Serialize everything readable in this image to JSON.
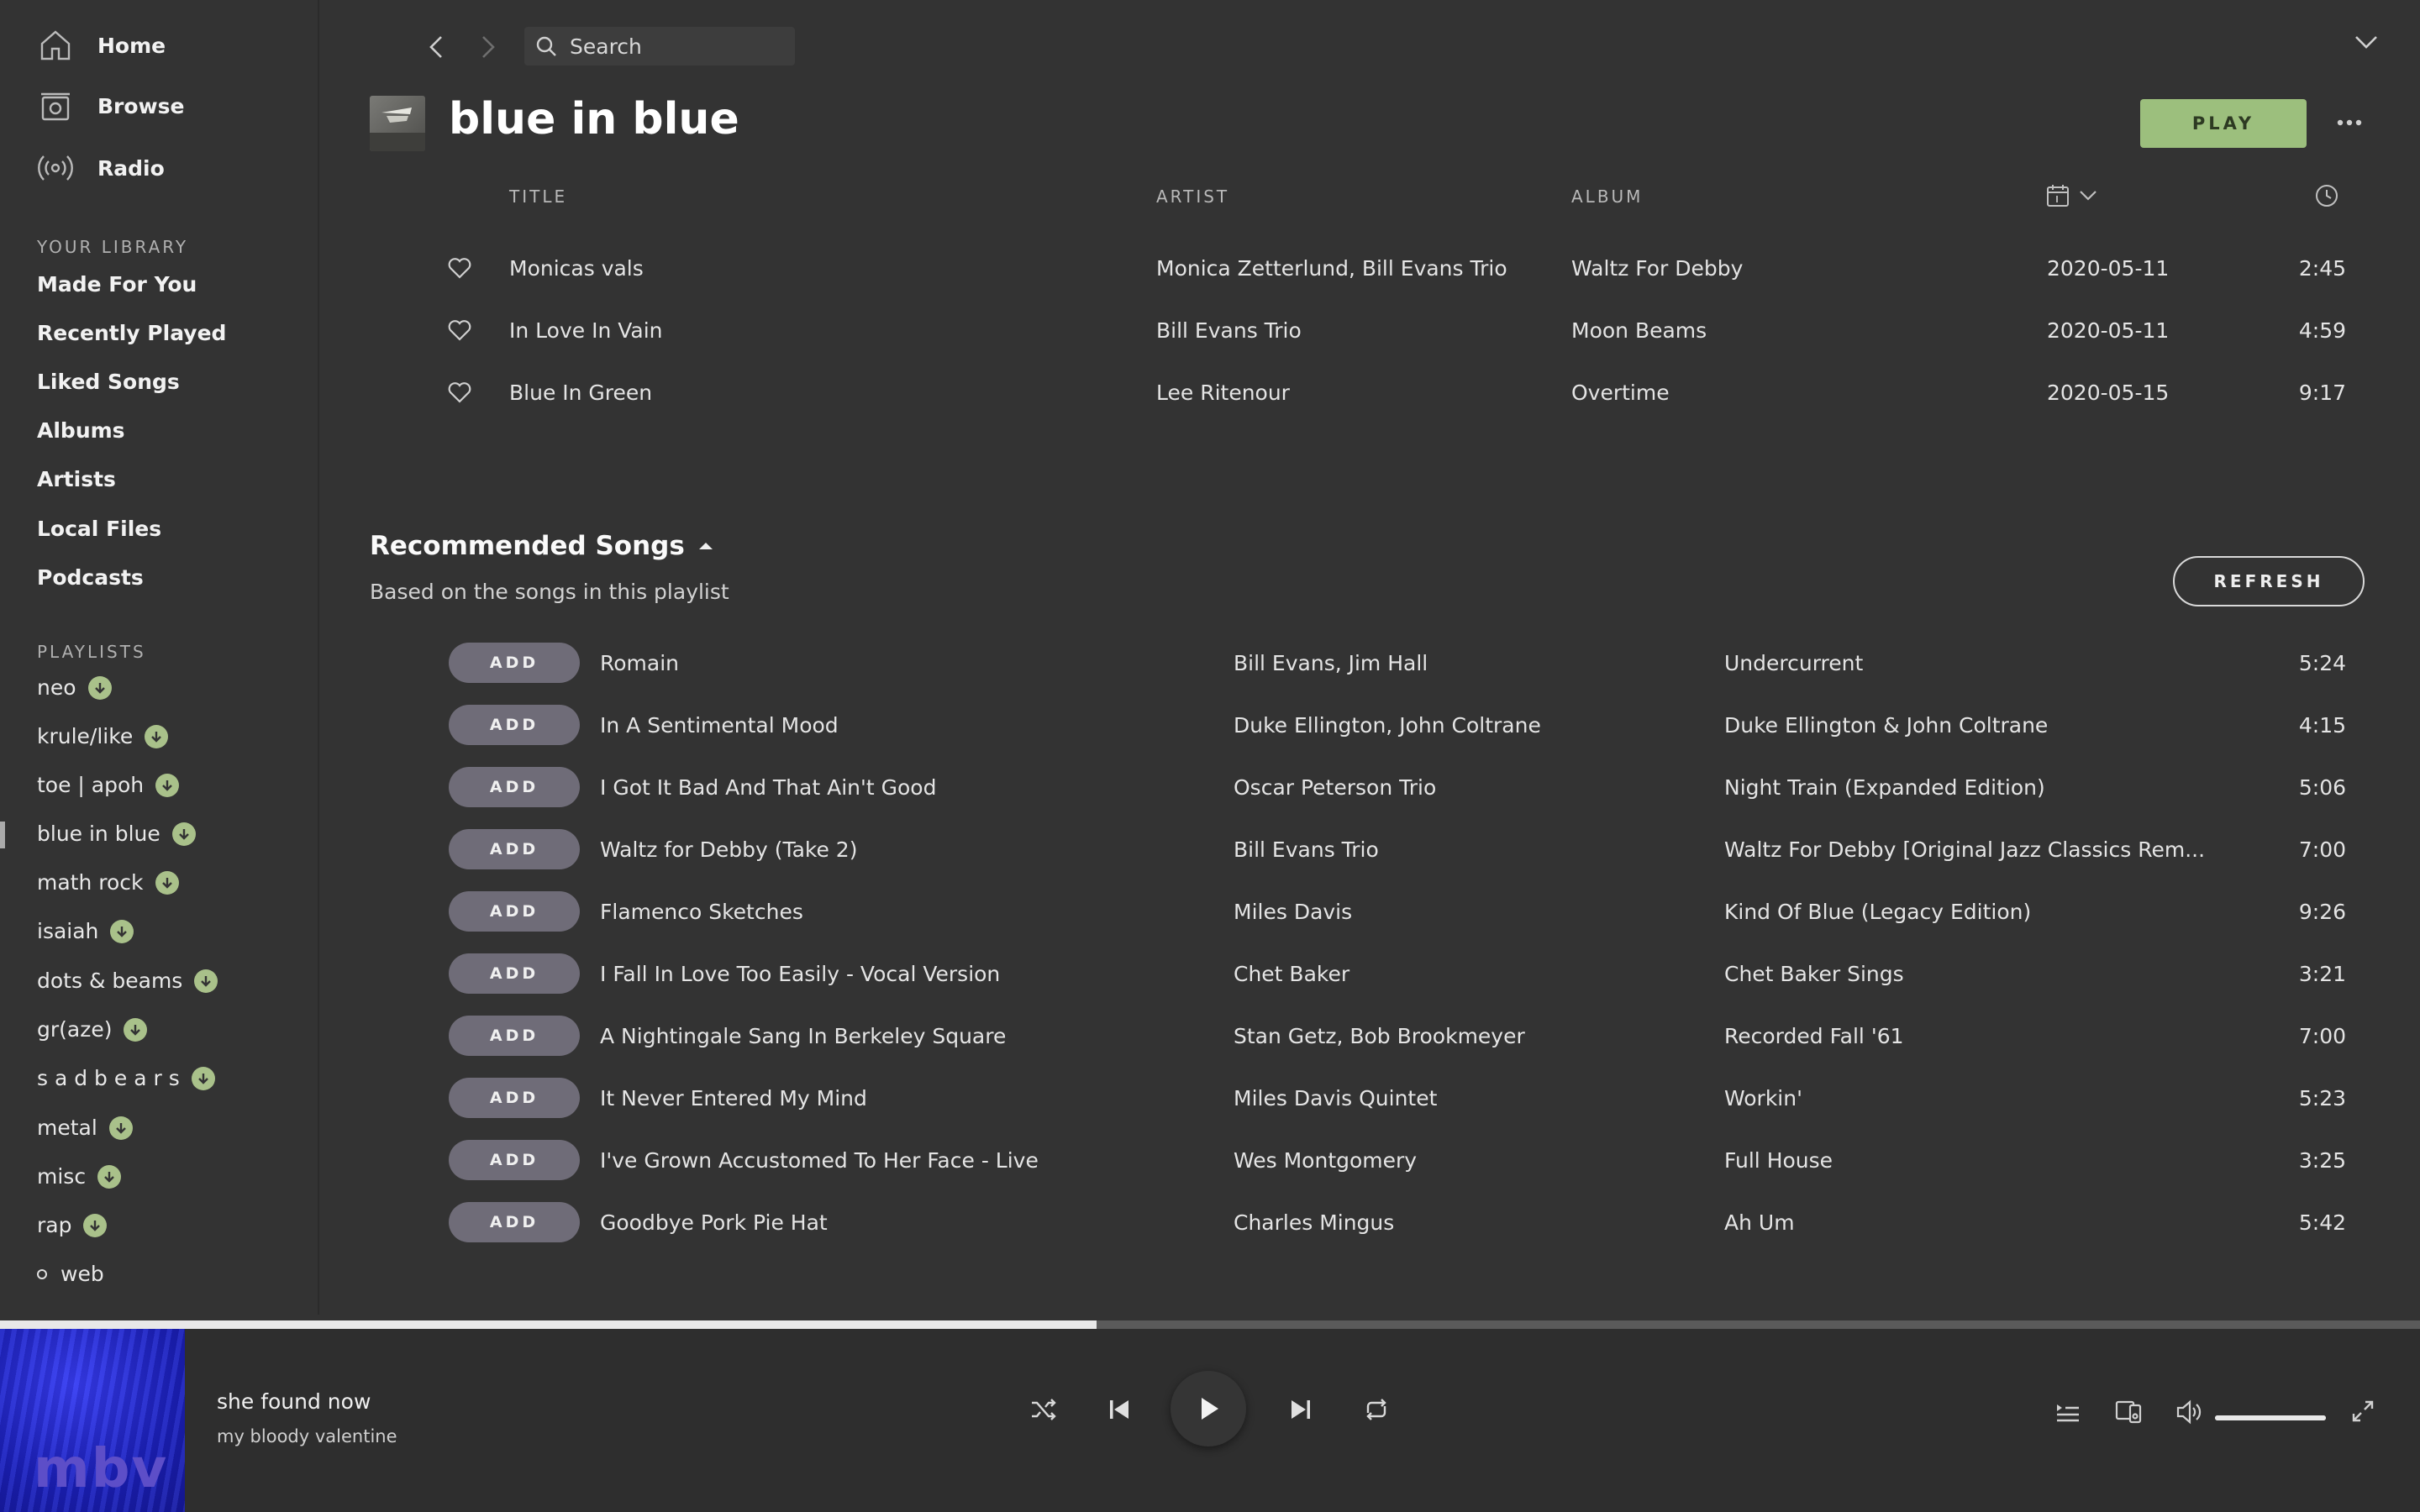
{
  "nav": {
    "home": "Home",
    "browse": "Browse",
    "radio": "Radio"
  },
  "library": {
    "heading": "YOUR LIBRARY",
    "items": [
      "Made For You",
      "Recently Played",
      "Liked Songs",
      "Albums",
      "Artists",
      "Local Files",
      "Podcasts"
    ]
  },
  "playlists": {
    "heading": "PLAYLISTS",
    "items": [
      "neo",
      "krule/like",
      "toe | apoh",
      "blue in blue",
      "math rock",
      "isaiah",
      "dots & beams",
      "gr(aze)",
      "s a d b e a r s",
      "metal",
      "misc",
      "rap",
      "web"
    ],
    "active": "blue in blue"
  },
  "search": {
    "label": "Search"
  },
  "playlist": {
    "title": "blue in blue",
    "play_label": "PLAY",
    "columns": {
      "title": "TITLE",
      "artist": "ARTIST",
      "album": "ALBUM"
    },
    "tracks": [
      {
        "title": "Monicas vals",
        "artist": "Monica Zetterlund, Bill Evans Trio",
        "album": "Waltz For Debby",
        "date": "2020-05-11",
        "duration": "2:45"
      },
      {
        "title": "In Love In Vain",
        "artist": "Bill Evans Trio",
        "album": "Moon Beams",
        "date": "2020-05-11",
        "duration": "4:59"
      },
      {
        "title": "Blue In Green",
        "artist": "Lee Ritenour",
        "album": "Overtime",
        "date": "2020-05-15",
        "duration": "9:17"
      }
    ]
  },
  "recommended": {
    "title": "Recommended Songs",
    "subtitle": "Based on the songs in this playlist",
    "refresh_label": "REFRESH",
    "add_label": "ADD",
    "songs": [
      {
        "title": "Romain",
        "artist": "Bill Evans, Jim Hall",
        "album": "Undercurrent",
        "duration": "5:24"
      },
      {
        "title": "In A Sentimental Mood",
        "artist": "Duke Ellington, John Coltrane",
        "album": "Duke Ellington & John Coltrane",
        "duration": "4:15"
      },
      {
        "title": "I Got It Bad And That Ain't Good",
        "artist": "Oscar Peterson Trio",
        "album": "Night Train (Expanded Edition)",
        "duration": "5:06"
      },
      {
        "title": "Waltz for Debby (Take 2)",
        "artist": "Bill Evans Trio",
        "album": "Waltz For Debby [Original Jazz Classics Rem...",
        "duration": "7:00"
      },
      {
        "title": "Flamenco Sketches",
        "artist": "Miles Davis",
        "album": "Kind Of Blue (Legacy Edition)",
        "duration": "9:26"
      },
      {
        "title": "I Fall In Love Too Easily - Vocal Version",
        "artist": "Chet Baker",
        "album": "Chet Baker Sings",
        "duration": "3:21"
      },
      {
        "title": "A Nightingale Sang In Berkeley Square",
        "artist": "Stan Getz, Bob Brookmeyer",
        "album": "Recorded Fall '61",
        "duration": "7:00"
      },
      {
        "title": "It Never Entered My Mind",
        "artist": "Miles Davis Quintet",
        "album": "Workin'",
        "duration": "5:23"
      },
      {
        "title": "I've Grown Accustomed To Her Face - Live",
        "artist": "Wes Montgomery",
        "album": "Full House",
        "duration": "3:25"
      },
      {
        "title": "Goodbye Pork Pie Hat",
        "artist": "Charles Mingus",
        "album": "Ah Um",
        "duration": "5:42"
      }
    ]
  },
  "player": {
    "track": "she found now",
    "artist": "my bloody valentine",
    "album_art_text": "mbv",
    "progress": 0.453,
    "volume": 1.0
  },
  "colors": {
    "background": "#333333",
    "accent_green": "#9cbf7d",
    "add_button": "#6f6c78",
    "player_bg": "#2e2e2e"
  }
}
